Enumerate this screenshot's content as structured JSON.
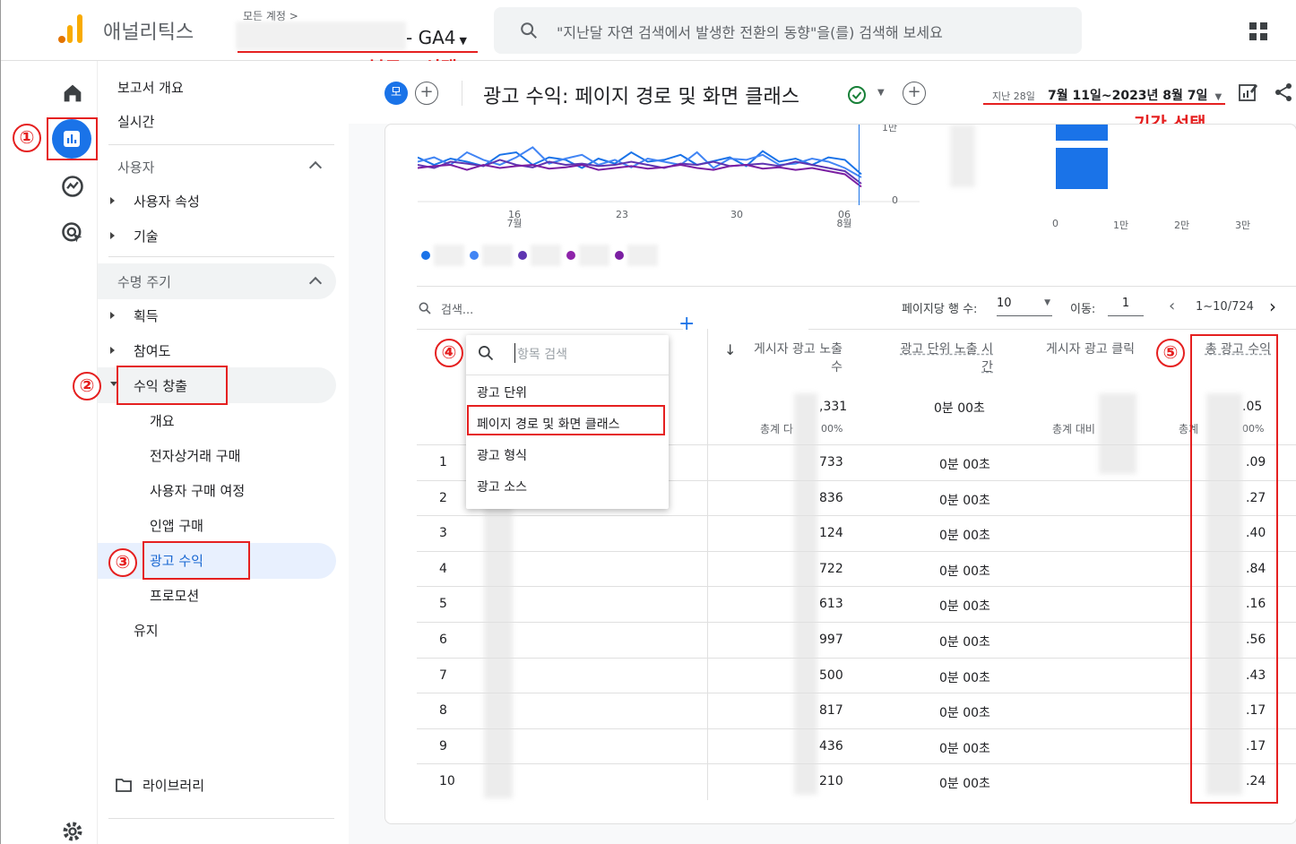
{
  "colors": {
    "accent": "#1a73e8",
    "annotation": "#e52020",
    "logo_orange": "#f9ab00",
    "logo_dark": "#e37400"
  },
  "topbar": {
    "app_name": "애널리틱스",
    "account_crumb": "모든 계정 >",
    "property_suffix": "- GA4",
    "search_placeholder": "\"지난달 자연 검색에서 발생한 전환의 동향\"을(를) 검색해 보세요"
  },
  "annotations": {
    "blog_select": "블로그 선택",
    "period_select": "기간 선택",
    "steps": [
      "①",
      "②",
      "③",
      "④",
      "⑤"
    ]
  },
  "nav": {
    "report_overview": "보고서 개요",
    "realtime": "실시간",
    "user_section": "사용자",
    "user_attributes": "사용자 속성",
    "tech": "기술",
    "lifecycle_section": "수명 주기",
    "acquisition": "획득",
    "engagement": "참여도",
    "monetization": "수익 창출",
    "sub_overview": "개요",
    "sub_ecommerce": "전자상거래 구매",
    "sub_journey": "사용자 구매 여정",
    "sub_inapp": "인앱 구매",
    "sub_ad_revenue": "광고 수익",
    "sub_promotion": "프로모션",
    "retention": "유지",
    "library": "라이브러리"
  },
  "header": {
    "avatar_letter": "모",
    "report_title": "광고 수익: 페이지 경로 및 화면 클래스",
    "date_prefix": "지난 28일",
    "date_range": "7월 11일~2023년 8월 7일"
  },
  "chart_data": [
    {
      "type": "line",
      "x": [
        "16 7월",
        "23",
        "30",
        "06 8월"
      ],
      "series": [
        {
          "color": "#1a73e8",
          "values": [
            0.62,
            0.5,
            0.6,
            0.55,
            0.48,
            0.66,
            0.7,
            0.5,
            0.62,
            0.58,
            0.45,
            0.6,
            0.52,
            0.7,
            0.55,
            0.58,
            0.66,
            0.5,
            0.56,
            0.62,
            0.48,
            0.72,
            0.55,
            0.6,
            0.5,
            0.62,
            0.58,
            0.35
          ]
        },
        {
          "color": "#4285f4",
          "values": [
            0.55,
            0.62,
            0.5,
            0.7,
            0.58,
            0.5,
            0.62,
            0.78,
            0.52,
            0.6,
            0.66,
            0.5,
            0.58,
            0.46,
            0.6,
            0.55,
            0.5,
            0.7,
            0.45,
            0.6,
            0.58,
            0.66,
            0.5,
            0.52,
            0.6,
            0.55,
            0.45,
            0.3
          ]
        },
        {
          "color": "#5e35b1",
          "values": [
            0.5,
            0.45,
            0.55,
            0.52,
            0.48,
            0.58,
            0.5,
            0.46,
            0.55,
            0.5,
            0.52,
            0.48,
            0.5,
            0.55,
            0.5,
            0.45,
            0.52,
            0.5,
            0.55,
            0.48,
            0.5,
            0.52,
            0.48,
            0.55,
            0.5,
            0.45,
            0.4,
            0.2
          ]
        },
        {
          "color": "#7b1fa2",
          "values": [
            0.45,
            0.48,
            0.5,
            0.42,
            0.5,
            0.45,
            0.48,
            0.5,
            0.44,
            0.46,
            0.5,
            0.42,
            0.45,
            0.48,
            0.44,
            0.46,
            0.5,
            0.45,
            0.42,
            0.48,
            0.5,
            0.44,
            0.46,
            0.42,
            0.45,
            0.4,
            0.35,
            0.15
          ]
        }
      ],
      "y_ticks": [
        "1만",
        "0"
      ]
    },
    {
      "type": "bar",
      "x_ticks": [
        "0",
        "1만",
        "2만",
        "3만"
      ]
    }
  ],
  "legend_colors": [
    "#1a73e8",
    "#4285f4",
    "#5e35b1",
    "#8e24aa",
    "#7b1fa2"
  ],
  "table": {
    "search_placeholder": "검색...",
    "rows_per_page_label": "페이지당 행 수:",
    "rows_per_page": "10",
    "goto_label": "이동:",
    "goto_value": "1",
    "pagination": "1~10/724",
    "dropdown": {
      "search_placeholder": "항목 검색",
      "items": [
        "광고 단위",
        "페이지 경로 및 화면 클래스",
        "광고 형식",
        "광고 소스"
      ]
    },
    "columns": {
      "col1": "게시자 광고 노출수",
      "col2": "광고 단위 노출 시간",
      "col3": "게시자 광고 클릭",
      "col4": "총 광고 수익"
    },
    "totals": {
      "col1_value": ",331",
      "col1_sub": "00%",
      "col1_label": "총계 다",
      "col2_value": "0분 00초",
      "col3_label": "총계 대비",
      "col4_value": ".05",
      "col4_sub": "00%",
      "col4_label": "총계"
    },
    "rows": [
      {
        "idx": "1",
        "c1": "733",
        "c2": "0분 00초",
        "c4": ".09"
      },
      {
        "idx": "2",
        "c1": "836",
        "c2": "0분 00초",
        "c4": ".27"
      },
      {
        "idx": "3",
        "c1": "124",
        "c2": "0분 00초",
        "c4": ".40"
      },
      {
        "idx": "4",
        "c1": "722",
        "c2": "0분 00초",
        "c4": ".84"
      },
      {
        "idx": "5",
        "c1": "613",
        "c2": "0분 00초",
        "c4": ".16"
      },
      {
        "idx": "6",
        "c1": "997",
        "c2": "0분 00초",
        "c4": ".56"
      },
      {
        "idx": "7",
        "c1": "500",
        "c2": "0분 00초",
        "c4": ".43"
      },
      {
        "idx": "8",
        "c1": "817",
        "c2": "0분 00초",
        "c4": ".17"
      },
      {
        "idx": "9",
        "c1": "436",
        "c2": "0분 00초",
        "c4": ".17"
      },
      {
        "idx": "10",
        "c1": "210",
        "c2": "0분 00초",
        "c4": ".24"
      }
    ]
  }
}
